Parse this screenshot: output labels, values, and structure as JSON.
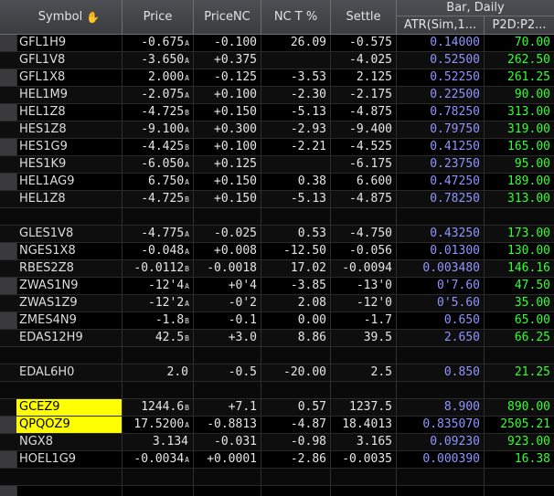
{
  "header": {
    "symbol": "Symbol",
    "price": "Price",
    "pricenc": "PriceNC",
    "nct": "NC T %",
    "settle": "Settle",
    "group": "Bar, Daily",
    "atr": "ATR(Sim,1...",
    "p2d": "P2D:P2..."
  },
  "icons": {
    "symbol_header": "hand-pointer-icon"
  },
  "colors": {
    "background": "#000000",
    "highlight": "#ffff00",
    "atr_text": "#8f95ff",
    "p2d_text": "#33ff33"
  },
  "rows": [
    {
      "symbol": "GFL1H9",
      "price": "-0.675",
      "flag": "A",
      "pricenc": "-0.100",
      "nct": "26.09",
      "settle": "-0.575",
      "atr": "0.14000",
      "p2d": "70.00"
    },
    {
      "symbol": "GFL1V8",
      "price": "-3.650",
      "flag": "A",
      "pricenc": "+0.375",
      "nct": "",
      "settle": "-4.025",
      "atr": "0.52500",
      "p2d": "262.50"
    },
    {
      "symbol": "GFL1X8",
      "price": "2.000",
      "flag": "A",
      "pricenc": "-0.125",
      "nct": "-3.53",
      "settle": "2.125",
      "atr": "0.52250",
      "p2d": "261.25"
    },
    {
      "symbol": "HEL1M9",
      "price": "-2.075",
      "flag": "A",
      "pricenc": "+0.100",
      "nct": "-2.30",
      "settle": "-2.175",
      "atr": "0.22500",
      "p2d": "90.00"
    },
    {
      "symbol": "HEL1Z8",
      "price": "-4.725",
      "flag": "B",
      "pricenc": "+0.150",
      "nct": "-5.13",
      "settle": "-4.875",
      "atr": "0.78250",
      "p2d": "313.00"
    },
    {
      "symbol": "HES1Z8",
      "price": "-9.100",
      "flag": "A",
      "pricenc": "+0.300",
      "nct": "-2.93",
      "settle": "-9.400",
      "atr": "0.79750",
      "p2d": "319.00"
    },
    {
      "symbol": "HES1G9",
      "price": "-4.425",
      "flag": "B",
      "pricenc": "+0.100",
      "nct": "-2.21",
      "settle": "-4.525",
      "atr": "0.41250",
      "p2d": "165.00"
    },
    {
      "symbol": "HES1K9",
      "price": "-6.050",
      "flag": "A",
      "pricenc": "+0.125",
      "nct": "",
      "settle": "-6.175",
      "atr": "0.23750",
      "p2d": "95.00"
    },
    {
      "symbol": "HEL1AG9",
      "price": "6.750",
      "flag": "A",
      "pricenc": "+0.150",
      "nct": "0.38",
      "settle": "6.600",
      "atr": "0.47250",
      "p2d": "189.00"
    },
    {
      "symbol": "HEL1Z8",
      "price": "-4.725",
      "flag": "B",
      "pricenc": "+0.150",
      "nct": "-5.13",
      "settle": "-4.875",
      "atr": "0.78250",
      "p2d": "313.00"
    },
    {
      "blank": true
    },
    {
      "symbol": "GLES1V8",
      "price": "-4.775",
      "flag": "A",
      "pricenc": "-0.025",
      "nct": "0.53",
      "settle": "-4.750",
      "atr": "0.43250",
      "p2d": "173.00"
    },
    {
      "symbol": "NGES1X8",
      "price": "-0.048",
      "flag": "A",
      "pricenc": "+0.008",
      "nct": "-12.50",
      "settle": "-0.056",
      "atr": "0.01300",
      "p2d": "130.00"
    },
    {
      "symbol": "RBES2Z8",
      "price": "-0.0112",
      "flag": "B",
      "pricenc": "-0.0018",
      "nct": "17.02",
      "settle": "-0.0094",
      "atr": "0.003480",
      "p2d": "146.16"
    },
    {
      "symbol": "ZWAS1N9",
      "price": "-12'4",
      "flag": "A",
      "pricenc": "+0'4",
      "nct": "-3.85",
      "settle": "-13'0",
      "atr": "0'7.60",
      "p2d": "47.50"
    },
    {
      "symbol": "ZWAS1Z9",
      "price": "-12'2",
      "flag": "A",
      "pricenc": "-0'2",
      "nct": "2.08",
      "settle": "-12'0",
      "atr": "0'5.60",
      "p2d": "35.00"
    },
    {
      "symbol": "ZMES4N9",
      "price": "-1.8",
      "flag": "B",
      "pricenc": "-0.1",
      "nct": "0.00",
      "settle": "-1.7",
      "atr": "0.650",
      "p2d": "65.00"
    },
    {
      "symbol": "EDAS12H9",
      "price": "42.5",
      "flag": "B",
      "pricenc": "+3.0",
      "nct": "8.86",
      "settle": "39.5",
      "atr": "2.650",
      "p2d": "66.25"
    },
    {
      "blank": true
    },
    {
      "symbol": "EDAL6H0",
      "price": "2.0",
      "flag": "",
      "pricenc": "-0.5",
      "nct": "-20.00",
      "settle": "2.5",
      "atr": "0.850",
      "p2d": "21.25"
    },
    {
      "blank": true
    },
    {
      "symbol": "GCEZ9",
      "highlight": true,
      "price": "1244.6",
      "flag": "B",
      "pricenc": "+7.1",
      "nct": "0.57",
      "settle": "1237.5",
      "atr": "8.900",
      "p2d": "890.00"
    },
    {
      "symbol": "QPQOZ9",
      "highlight": true,
      "price": "17.5200",
      "flag": "A",
      "pricenc": "-0.8813",
      "nct": "-4.87",
      "settle": "18.4013",
      "atr": "0.835070",
      "p2d": "2505.21"
    },
    {
      "symbol": "NGX8",
      "price": "3.134",
      "flag": "",
      "pricenc": "-0.031",
      "nct": "-0.98",
      "settle": "3.165",
      "atr": "0.09230",
      "p2d": "923.00"
    },
    {
      "symbol": "HOEL1G9",
      "price": "-0.0034",
      "flag": "A",
      "pricenc": "+0.0001",
      "nct": "-2.86",
      "settle": "-0.0035",
      "atr": "0.000390",
      "p2d": "16.38"
    },
    {
      "blank": true
    }
  ]
}
